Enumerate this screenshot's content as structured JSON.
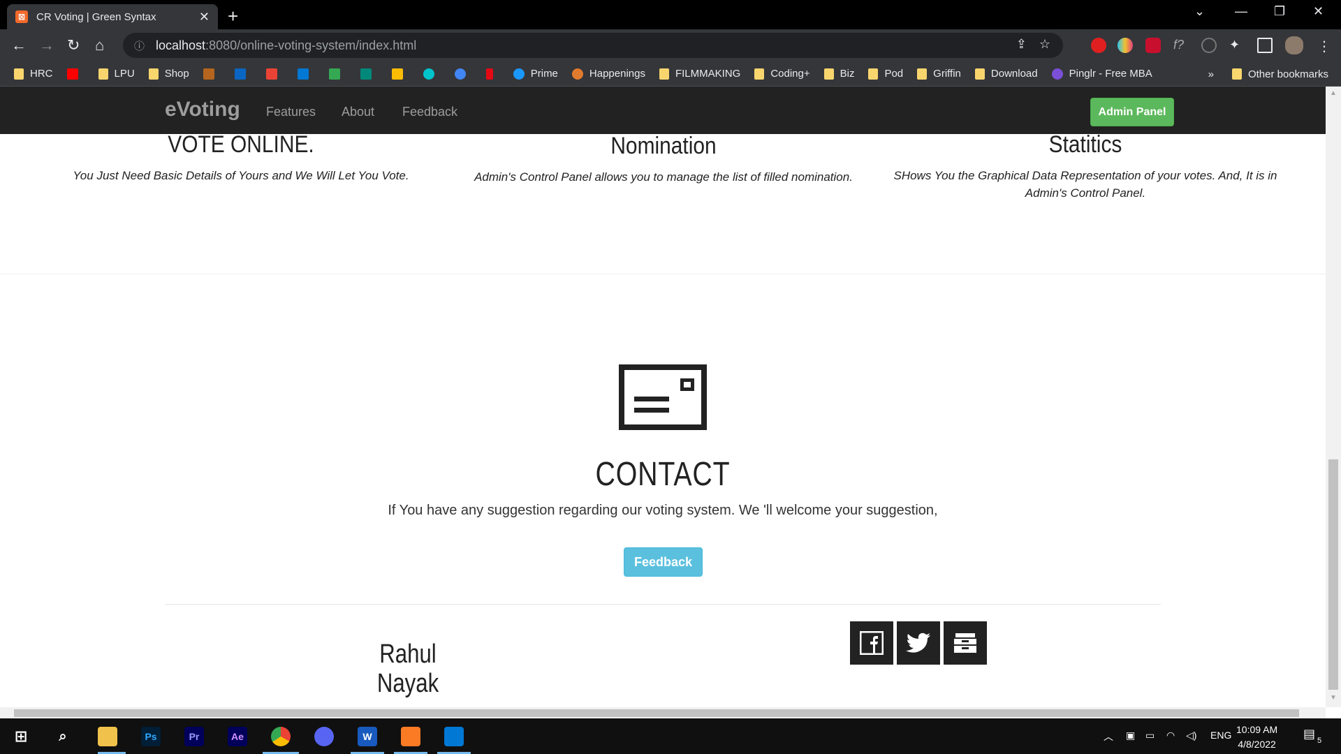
{
  "browser": {
    "tab_title": "CR Voting | Green Syntax",
    "tab_close": "✕",
    "new_tab": "+",
    "url_host": "localhost",
    "url_path": ":8080/online-voting-system/index.html",
    "bookmarks": [
      {
        "label": "HRC",
        "icon": "folder-icon"
      },
      {
        "label": "",
        "icon": "youtube-icon"
      },
      {
        "label": "LPU",
        "icon": "folder-icon"
      },
      {
        "label": "Shop",
        "icon": "folder-icon"
      },
      {
        "label": "",
        "icon": "app-icon"
      },
      {
        "label": "",
        "icon": "linkedin-icon"
      },
      {
        "label": "",
        "icon": "gmail-icon"
      },
      {
        "label": "",
        "icon": "outlook-icon"
      },
      {
        "label": "",
        "icon": "drive-icon"
      },
      {
        "label": "",
        "icon": "meet-icon"
      },
      {
        "label": "",
        "icon": "keep-icon"
      },
      {
        "label": "",
        "icon": "canva-icon"
      },
      {
        "label": "",
        "icon": "podcast-icon"
      },
      {
        "label": "",
        "icon": "netflix-icon"
      },
      {
        "label": "Prime",
        "icon": "prime-icon"
      },
      {
        "label": "Happenings",
        "icon": "happenings-icon"
      },
      {
        "label": "FILMMAKING",
        "icon": "folder-icon"
      },
      {
        "label": "Coding+",
        "icon": "folder-icon"
      },
      {
        "label": "Biz",
        "icon": "folder-icon"
      },
      {
        "label": "Pod",
        "icon": "folder-icon"
      },
      {
        "label": "Griffin",
        "icon": "folder-icon"
      },
      {
        "label": "Download",
        "icon": "folder-icon"
      },
      {
        "label": "Pinglr - Free MBA",
        "icon": "pinglr-icon"
      }
    ],
    "more_bookmarks": "»",
    "other_bookmarks": "Other bookmarks"
  },
  "site": {
    "brand": "eVoting",
    "nav": [
      "Features",
      "About",
      "Feedback"
    ],
    "admin_button": "Admin Panel",
    "features": [
      {
        "title": "VOTE ONLINE.",
        "text": "You Just Need Basic Details of Yours and We Will Let You Vote."
      },
      {
        "title": "Nomination",
        "text": "Admin's Control Panel allows you to manage the list of filled nomination."
      },
      {
        "title": "Statitics",
        "text": "SHows You the Graphical Data Representation of your votes. And, It is in Admin's Control Panel."
      }
    ],
    "contact_title": "CONTACT",
    "contact_text": "If You have any suggestion regarding our voting system. We 'll welcome your suggestion,",
    "feedback_button": "Feedback",
    "author": "Rahul Nayak",
    "social": [
      "facebook-icon",
      "twitter-icon",
      "archive-icon"
    ]
  },
  "taskbar": {
    "apps": [
      "file-explorer-icon",
      "photoshop-icon",
      "premiere-icon",
      "after-effects-icon",
      "chrome-icon",
      "discord-icon",
      "word-icon",
      "xampp-icon",
      "vscode-icon"
    ],
    "app_labels": {
      "ps": "Ps",
      "pr": "Pr",
      "ae": "Ae",
      "word": "W"
    },
    "language": "ENG",
    "time": "10:09 AM",
    "date": "4/8/2022",
    "notification_count": "5"
  }
}
